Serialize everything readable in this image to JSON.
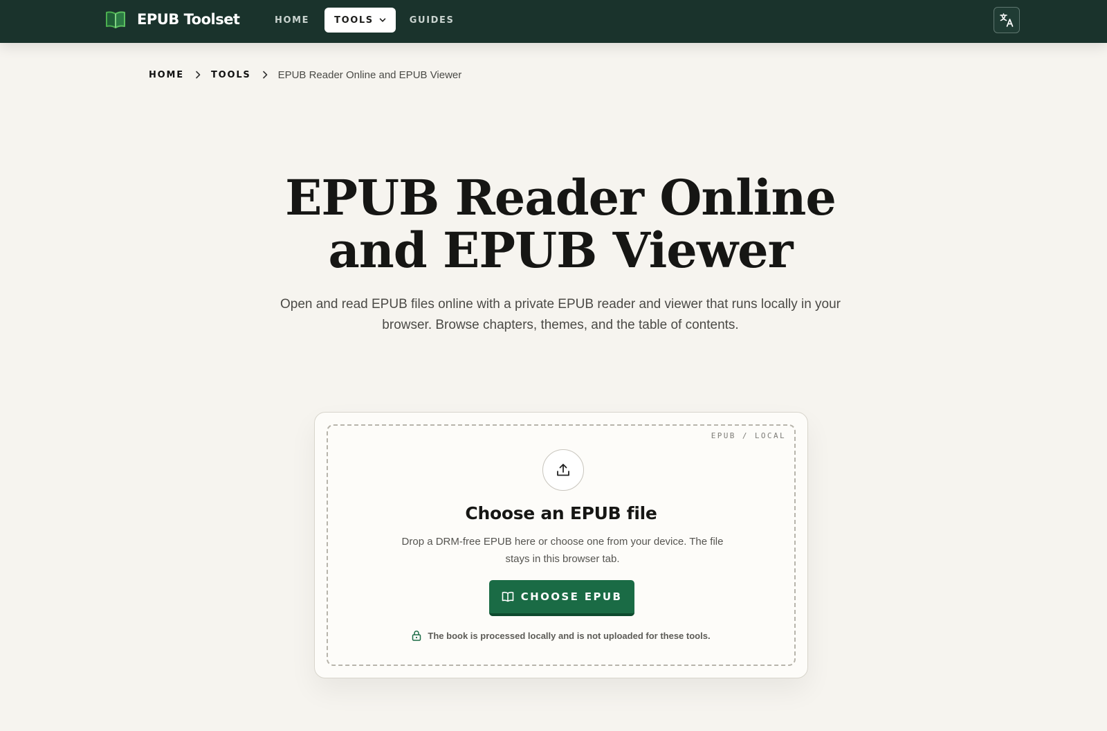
{
  "brand": {
    "name": "EPUB Toolset",
    "icon": "book-logo-icon"
  },
  "nav": {
    "items": [
      {
        "label": "HOME"
      },
      {
        "label": "TOOLS",
        "active": true,
        "has_dropdown": true
      },
      {
        "label": "GUIDES"
      }
    ],
    "language_icon": "translate-icon"
  },
  "breadcrumb": {
    "items": [
      "HOME",
      "TOOLS"
    ],
    "current": "EPUB Reader Online and EPUB Viewer"
  },
  "hero": {
    "title_line1": "EPUB Reader Online",
    "title_line2": "and EPUB Viewer",
    "subtitle": "Open and read EPUB files online with a private EPUB reader and viewer that runs locally in your browser. Browse chapters, themes, and the table of contents."
  },
  "uploader": {
    "tag": "EPUB / LOCAL",
    "icon": "upload-icon",
    "title": "Choose an EPUB file",
    "description": "Drop a DRM-free EPUB here or choose one from your device. The file stays in this browser tab.",
    "button_label": "CHOOSE EPUB",
    "button_icon": "open-book-icon",
    "privacy_note": "The book is processed locally and is not uploaded for these tools.",
    "privacy_icon": "lock-icon"
  },
  "colors": {
    "header_bg": "#1a332c",
    "page_bg": "#f6f4ef",
    "accent_green": "#1a6b45",
    "logo_green": "#4caf50"
  }
}
